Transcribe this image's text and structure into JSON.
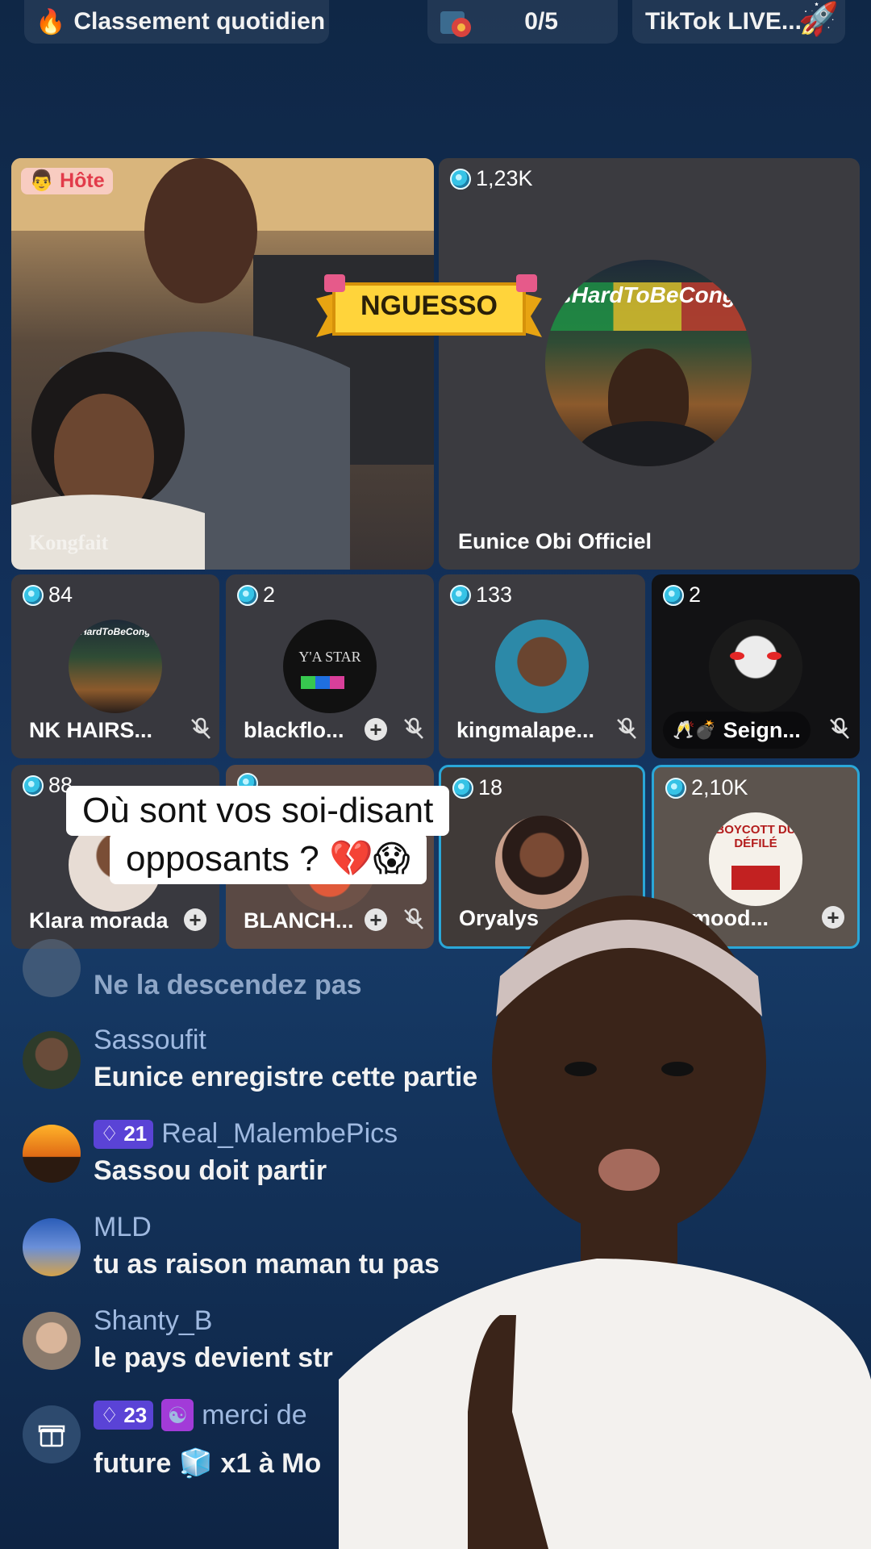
{
  "top_bar": {
    "daily_rank_label": "Classement quotidien",
    "goal_progress": "0/5",
    "live_label": "TikTok LIVE..."
  },
  "host_tile": {
    "badge": "Hôte",
    "watermark": "Kongfait"
  },
  "banner": {
    "text": "NGUESSO"
  },
  "featured_tile": {
    "count": "1,23K",
    "name": "Eunice Obi Officiel",
    "avatar_text": "ItsHardToBeCongolese"
  },
  "guest_row_1": [
    {
      "count": "84",
      "name": "NK HAIRS...",
      "action": "mic-off",
      "avatar_text": "ItsHardToBeCongolese"
    },
    {
      "count": "2",
      "name": "blackflo...",
      "action": "plus+mic-off",
      "avatar_text": "Y'A STAR"
    },
    {
      "count": "133",
      "name": "kingmalape...",
      "action": "mic-off"
    },
    {
      "count": "2",
      "name": "Seign...",
      "action": "mic-off"
    }
  ],
  "guest_row_2": [
    {
      "count": "88",
      "name": "Klara morada",
      "action": "plus"
    },
    {
      "count": "",
      "name": "BLANCH...",
      "action": "plus+mic-off"
    },
    {
      "count": "18",
      "name": "Oryalys",
      "action": ""
    },
    {
      "count": "2,10K",
      "name": "n mood...",
      "action": "plus",
      "avatar_text": "BOYCOTT DU DÉFILÉ"
    }
  ],
  "caption": {
    "line1": "Où sont vos soi-disant",
    "line2": "opposants ? 💔😱"
  },
  "chat": [
    {
      "user": "",
      "level": "",
      "message": "Ne la descendez pas"
    },
    {
      "user": "Sassoufit",
      "level": "",
      "message": "Eunice enregistre cette partie"
    },
    {
      "user": "Real_MalembePics",
      "level": "21",
      "message": "Sassou doit partir"
    },
    {
      "user": "MLD",
      "level": "",
      "message": "tu as raison maman tu pas"
    },
    {
      "user": "Shanty_B",
      "level": "",
      "message": "le pays devient str"
    },
    {
      "user": "merci de",
      "level": "23",
      "message": "future 🧊 x1 à Mo"
    }
  ],
  "colors": {
    "background": "#12305a",
    "username": "#9fb9e0",
    "level_badge": "#5a43d6",
    "host_badge": "#e23b4a",
    "tile_highlight": "#2aa7d8"
  }
}
